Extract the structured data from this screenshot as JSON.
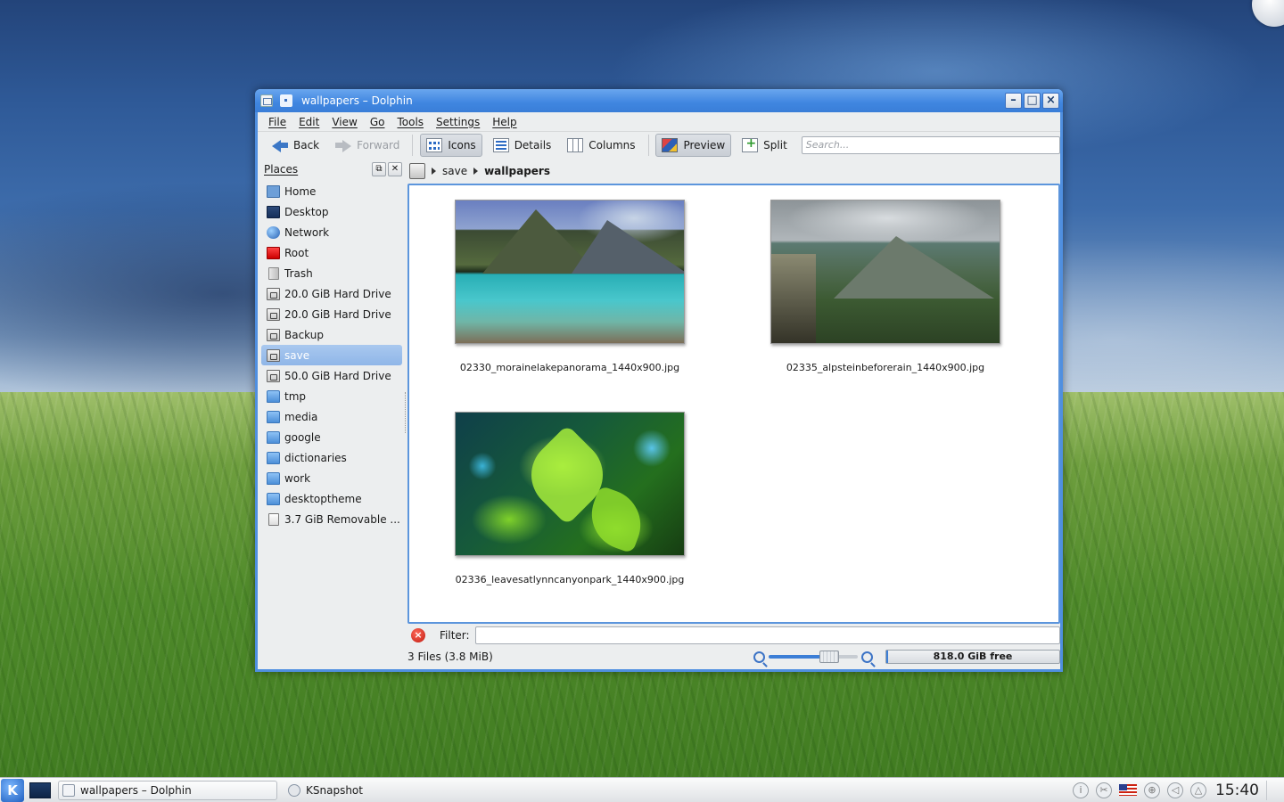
{
  "window": {
    "title": "wallpapers – Dolphin",
    "controls": {
      "minimize": "–",
      "maximize": "□",
      "close": "×"
    }
  },
  "menu": [
    "File",
    "Edit",
    "View",
    "Go",
    "Tools",
    "Settings",
    "Help"
  ],
  "toolbar": {
    "back": "Back",
    "forward": "Forward",
    "icons": "Icons",
    "details": "Details",
    "columns": "Columns",
    "preview": "Preview",
    "split": "Split",
    "search_placeholder": "Search..."
  },
  "places": {
    "title": "Places",
    "items": [
      {
        "label": "Home",
        "icon": "home-icon"
      },
      {
        "label": "Desktop",
        "icon": "desktop-icon"
      },
      {
        "label": "Network",
        "icon": "network-icon"
      },
      {
        "label": "Root",
        "icon": "root-folder-icon"
      },
      {
        "label": "Trash",
        "icon": "trash-icon"
      },
      {
        "label": "20.0 GiB Hard Drive",
        "icon": "hard-drive-icon"
      },
      {
        "label": "20.0 GiB Hard Drive",
        "icon": "hard-drive-icon"
      },
      {
        "label": "Backup",
        "icon": "hard-drive-icon"
      },
      {
        "label": "save",
        "icon": "hard-drive-icon",
        "selected": true
      },
      {
        "label": "50.0 GiB Hard Drive",
        "icon": "hard-drive-icon"
      },
      {
        "label": "tmp",
        "icon": "folder-icon"
      },
      {
        "label": "media",
        "icon": "folder-icon"
      },
      {
        "label": "google",
        "icon": "folder-icon"
      },
      {
        "label": "dictionaries",
        "icon": "folder-icon"
      },
      {
        "label": "work",
        "icon": "folder-icon"
      },
      {
        "label": "desktoptheme",
        "icon": "folder-icon"
      },
      {
        "label": "3.7 GiB Removable ...",
        "icon": "removable-drive-icon"
      }
    ]
  },
  "breadcrumb": {
    "parent": "save",
    "current": "wallpapers"
  },
  "files": [
    {
      "name": "02330_morainelakepanorama_1440x900.jpg"
    },
    {
      "name": "02335_alpsteinbeforerain_1440x900.jpg"
    },
    {
      "name": "02336_leavesatlynncanyonpark_1440x900.jpg"
    }
  ],
  "filter": {
    "label": "Filter:",
    "value": ""
  },
  "status": {
    "summary": "3 Files (3.8 MiB)",
    "free_space": "818.0 GiB free",
    "zoom_level_fraction": 0.65
  },
  "taskbar": {
    "tasks": [
      {
        "label": "wallpapers – Dolphin",
        "active": true
      },
      {
        "label": "KSnapshot",
        "active": false
      }
    ],
    "clock": "15:40"
  },
  "colors": {
    "accent": "#4f8fe0",
    "selection": "#8fb6e8"
  }
}
